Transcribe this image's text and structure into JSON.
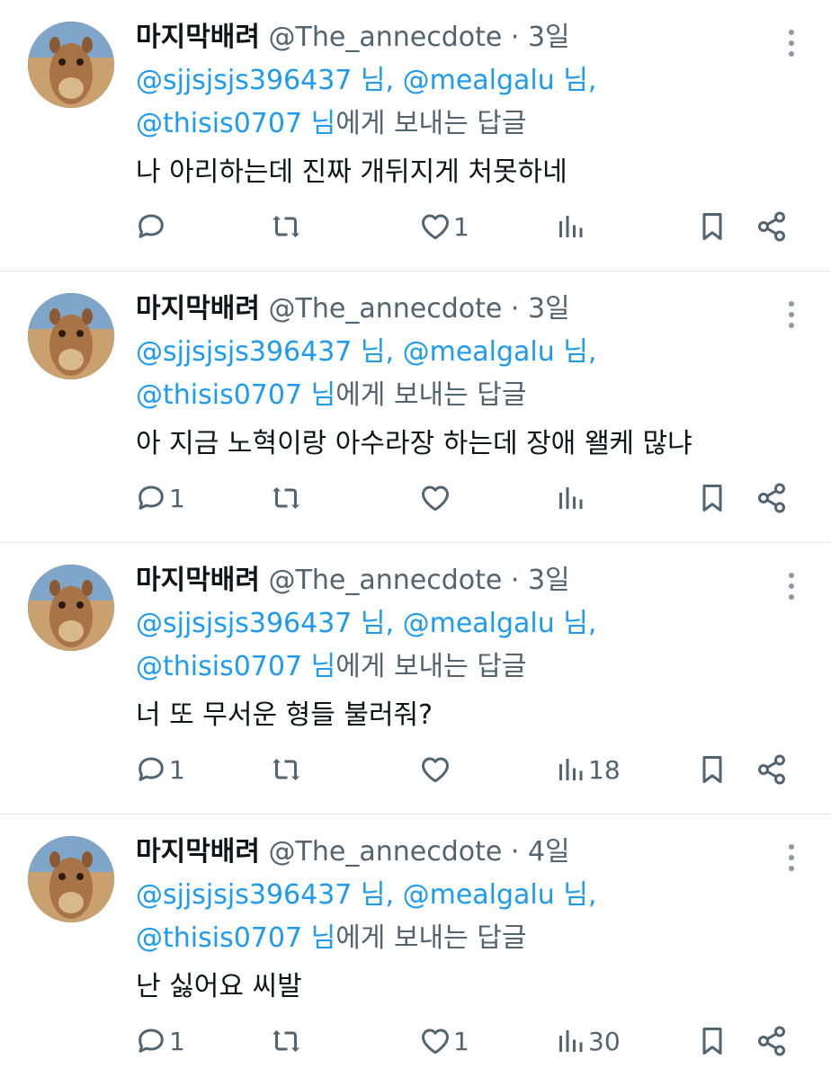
{
  "tweets": [
    {
      "name": "마지막배려",
      "handle": "@The_annecdote",
      "dot": "·",
      "time": "3일",
      "mention1": "@sjjsjsjs396437 님, @mealgalu 님,",
      "mention2": "@thisis0707 님",
      "reply_suffix": "에게 보내는 답글",
      "text": "나 아리하는데 진짜 개뒤지게 처못하네",
      "replies": "",
      "retweets": "",
      "likes": "1",
      "views": ""
    },
    {
      "name": "마지막배려",
      "handle": "@The_annecdote",
      "dot": "·",
      "time": "3일",
      "mention1": "@sjjsjsjs396437 님, @mealgalu 님,",
      "mention2": "@thisis0707 님",
      "reply_suffix": "에게 보내는 답글",
      "text": "아 지금 노혁이랑 아수라장 하는데 장애 왤케 많냐",
      "replies": "1",
      "retweets": "",
      "likes": "",
      "views": ""
    },
    {
      "name": "마지막배려",
      "handle": "@The_annecdote",
      "dot": "·",
      "time": "3일",
      "mention1": "@sjjsjsjs396437 님, @mealgalu 님,",
      "mention2": "@thisis0707 님",
      "reply_suffix": "에게 보내는 답글",
      "text": "너 또 무서운 형들 불러줘?",
      "replies": "1",
      "retweets": "",
      "likes": "",
      "views": "18"
    },
    {
      "name": "마지막배려",
      "handle": "@The_annecdote",
      "dot": "·",
      "time": "4일",
      "mention1": "@sjjsjsjs396437 님, @mealgalu 님,",
      "mention2": "@thisis0707 님",
      "reply_suffix": "에게 보내는 답글",
      "text": "난 싫어요 씨발",
      "replies": "1",
      "retweets": "",
      "likes": "1",
      "views": "30"
    }
  ],
  "icons": {
    "avatar": "camel-avatar",
    "more": "more-vertical-icon",
    "reply": "reply-icon",
    "retweet": "retweet-icon",
    "like": "heart-icon",
    "views": "views-icon",
    "bookmark": "bookmark-icon",
    "share": "share-icon"
  },
  "colors": {
    "text": "#0f1419",
    "secondary": "#536471",
    "mention": "#1d9bf0",
    "divider": "#e6e9eb"
  }
}
